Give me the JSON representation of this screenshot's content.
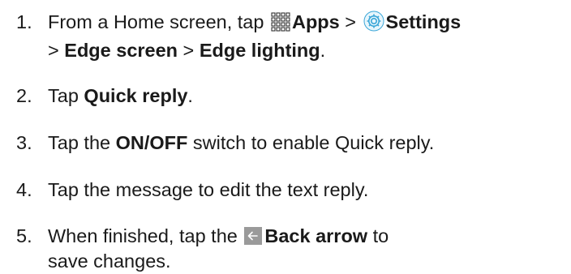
{
  "steps": [
    {
      "number": "1.",
      "line1": {
        "t1": "From a Home screen, tap ",
        "apps": "Apps",
        "sep": " > ",
        "settings": "Settings"
      },
      "line2": {
        "sep1": "> ",
        "edge_screen": "Edge screen",
        "sep2": " > ",
        "edge_lighting": "Edge lighting",
        "end": "."
      }
    },
    {
      "number": "2.",
      "t1": "Tap ",
      "bold": "Quick reply",
      "end": "."
    },
    {
      "number": "3.",
      "t1": "Tap the ",
      "bold": "ON/OFF",
      "t2": " switch to enable Quick reply."
    },
    {
      "number": "4.",
      "text": "Tap the message to edit the text reply."
    },
    {
      "number": "5.",
      "line1": {
        "t1": "When finished, tap the ",
        "bold": "Back arrow",
        "t2": " to"
      },
      "line2": {
        "text": "save changes."
      }
    }
  ],
  "icons": {
    "apps": "apps-grid-icon",
    "settings": "settings-gear-icon",
    "back": "back-arrow-icon"
  },
  "colors": {
    "text": "#1a1a1a",
    "settings_icon": "#3aa6d8",
    "back_box": "#9a9a9a"
  }
}
